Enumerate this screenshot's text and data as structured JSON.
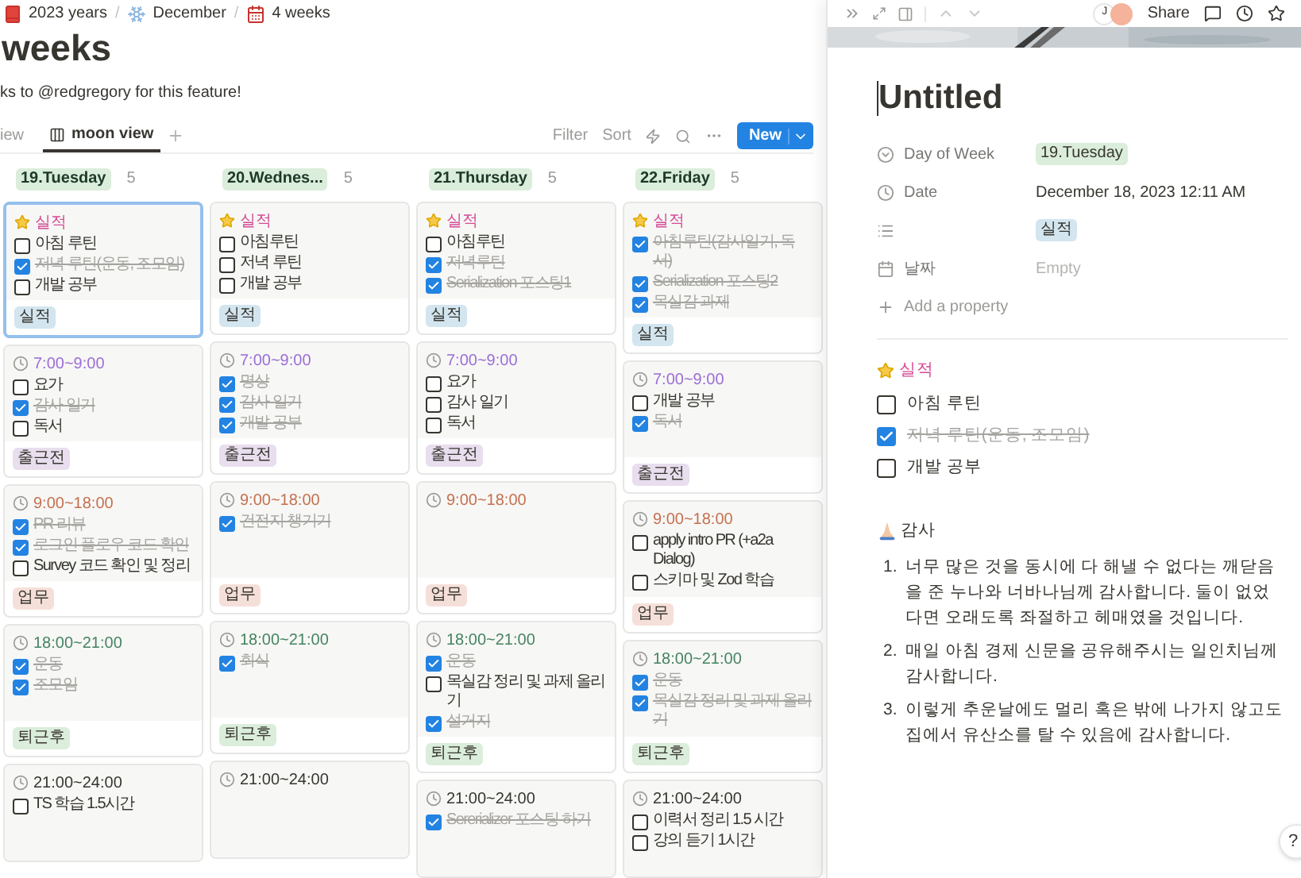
{
  "breadcrumb": [
    {
      "label": "2023 years",
      "kind": "book"
    },
    {
      "separator": "/",
      "label": "December",
      "kind": "snowflake"
    },
    {
      "separator": "/",
      "label": "4 weeks",
      "kind": "calendar"
    }
  ],
  "page": {
    "title": "weeks",
    "description": "ks to @redgregory for this feature!"
  },
  "views": [
    {
      "label": "iew",
      "kind": "plain",
      "selected": false
    },
    {
      "label": "moon view",
      "kind": "board",
      "selected": true
    }
  ],
  "toolbar": {
    "filter": "Filter",
    "sort": "Sort",
    "new_button": "New"
  },
  "columns": [
    {
      "label": "19.Tuesday",
      "count": "5",
      "cards": [
        {
          "kind": "star",
          "title": "실적",
          "color": "#d44c95",
          "selected": true,
          "items": [
            {
              "text": "아침 루틴",
              "checked": false
            },
            {
              "text": "저녁 루틴(운동, 조모임)",
              "checked": true
            },
            {
              "text": "개발 공부",
              "checked": false
            }
          ],
          "tag": {
            "label": "실적",
            "color": "#d3e5ef"
          }
        },
        {
          "kind": "clock",
          "title": "7:00~9:00",
          "color": "#9a6dd7",
          "selected": false,
          "items": [
            {
              "text": "요가",
              "checked": false
            },
            {
              "text": "감사 일기",
              "checked": true
            },
            {
              "text": "독서",
              "checked": false
            }
          ],
          "tag": {
            "label": "출근전",
            "color": "#e8deee"
          }
        },
        {
          "kind": "clock",
          "title": "9:00~18:00",
          "color": "#c4704e",
          "selected": false,
          "items": [
            {
              "text": "PR 리뷰",
              "checked": true
            },
            {
              "text": "로그인 플로우 코드 확인",
              "checked": true
            },
            {
              "text": "Survey 코드 확인 및 정리",
              "checked": false
            }
          ],
          "tag": {
            "label": "업무",
            "color": "#f5e0d9"
          }
        },
        {
          "kind": "clock",
          "title": "18:00~21:00",
          "color": "#448361",
          "selected": false,
          "items": [
            {
              "text": "운동",
              "checked": true
            },
            {
              "text": "조모임",
              "checked": true
            }
          ],
          "tag": {
            "label": "퇴근후",
            "color": "#dbeddb"
          }
        },
        {
          "kind": "clock",
          "title": "21:00~24:00",
          "color": "#37352f",
          "selected": false,
          "items": [
            {
              "text": "TS 학습 1.5시간",
              "checked": false
            }
          ]
        }
      ]
    },
    {
      "label": "20.Wednes...",
      "count": "5",
      "cards": [
        {
          "kind": "star",
          "title": "실적",
          "color": "#d44c95",
          "selected": false,
          "items": [
            {
              "text": "아침루틴",
              "checked": false
            },
            {
              "text": "저녁 루틴",
              "checked": false
            },
            {
              "text": "개발 공부",
              "checked": false
            }
          ],
          "tag": {
            "label": "실적",
            "color": "#d3e5ef"
          }
        },
        {
          "kind": "clock",
          "title": "7:00~9:00",
          "color": "#9a6dd7",
          "selected": false,
          "items": [
            {
              "text": "명상",
              "checked": true
            },
            {
              "text": "감사 일기",
              "checked": true
            },
            {
              "text": "개발 공부",
              "checked": true
            }
          ],
          "tag": {
            "label": "출근전",
            "color": "#e8deee"
          }
        },
        {
          "kind": "clock",
          "title": "9:00~18:00",
          "color": "#c4704e",
          "selected": false,
          "items": [
            {
              "text": "건전지 챙기기",
              "checked": true
            }
          ],
          "tag": {
            "label": "업무",
            "color": "#f5e0d9"
          }
        },
        {
          "kind": "clock",
          "title": "18:00~21:00",
          "color": "#448361",
          "selected": false,
          "items": [
            {
              "text": "회식",
              "checked": true
            }
          ],
          "tag": {
            "label": "퇴근후",
            "color": "#dbeddb"
          }
        },
        {
          "kind": "clock",
          "title": "21:00~24:00",
          "color": "#37352f",
          "selected": false
        }
      ]
    },
    {
      "label": "21.Thursday",
      "count": "5",
      "cards": [
        {
          "kind": "star",
          "title": "실적",
          "color": "#d44c95",
          "selected": false,
          "items": [
            {
              "text": "아침루틴",
              "checked": false
            },
            {
              "text": "저녁루틴",
              "checked": true
            },
            {
              "text": "Serialization 포스팅1",
              "checked": true
            }
          ],
          "tag": {
            "label": "실적",
            "color": "#d3e5ef"
          }
        },
        {
          "kind": "clock",
          "title": "7:00~9:00",
          "color": "#9a6dd7",
          "selected": false,
          "items": [
            {
              "text": "요가",
              "checked": false
            },
            {
              "text": "감사 일기",
              "checked": false
            },
            {
              "text": "독서",
              "checked": false
            }
          ],
          "tag": {
            "label": "출근전",
            "color": "#e8deee"
          }
        },
        {
          "kind": "clock",
          "title": "9:00~18:00",
          "color": "#c4704e",
          "selected": false,
          "tag": {
            "label": "업무",
            "color": "#f5e0d9"
          }
        },
        {
          "kind": "clock",
          "title": "18:00~21:00",
          "color": "#448361",
          "selected": false,
          "items": [
            {
              "text": "운동",
              "checked": true
            },
            {
              "text": "목실감 정리 및 과제 올리기",
              "checked": false
            },
            {
              "text": "설거지",
              "checked": true
            }
          ],
          "tag": {
            "label": "퇴근후",
            "color": "#dbeddb"
          }
        },
        {
          "kind": "clock",
          "title": "21:00~24:00",
          "color": "#37352f",
          "selected": false,
          "items": [
            {
              "text": "Sererializer 포스팅 하기",
              "checked": true
            }
          ]
        }
      ]
    },
    {
      "label": "22.Friday",
      "count": "5",
      "cards": [
        {
          "kind": "star",
          "title": "실적",
          "color": "#d44c95",
          "selected": false,
          "items": [
            {
              "text": "아침루틴(감사일기, 독서)",
              "checked": true
            },
            {
              "text": "Serialization 포스팅2",
              "checked": true
            },
            {
              "text": "목실감 과제",
              "checked": true
            }
          ],
          "tag": {
            "label": "실적",
            "color": "#d3e5ef"
          }
        },
        {
          "kind": "clock",
          "title": "7:00~9:00",
          "color": "#9a6dd7",
          "selected": false,
          "items": [
            {
              "text": "개발 공부",
              "checked": false
            },
            {
              "text": "독서",
              "checked": true
            }
          ],
          "tag": {
            "label": "출근전",
            "color": "#e8deee"
          }
        },
        {
          "kind": "clock",
          "title": "9:00~18:00",
          "color": "#c4704e",
          "selected": false,
          "items": [
            {
              "text": "apply intro PR (+a2a Dialog)",
              "checked": false
            },
            {
              "text": "스키마 및 Zod 학습",
              "checked": false
            }
          ],
          "tag": {
            "label": "업무",
            "color": "#f5e0d9"
          }
        },
        {
          "kind": "clock",
          "title": "18:00~21:00",
          "color": "#448361",
          "selected": false,
          "items": [
            {
              "text": "운동",
              "checked": true
            },
            {
              "text": "목실감 정리 및 과제 올리기",
              "checked": true
            }
          ],
          "tag": {
            "label": "퇴근후",
            "color": "#dbeddb"
          }
        },
        {
          "kind": "clock",
          "title": "21:00~24:00",
          "color": "#37352f",
          "selected": false,
          "items": [
            {
              "text": "이력서 정리 1.5 시간",
              "checked": false
            },
            {
              "text": "강의 듣기 1시간",
              "checked": false
            }
          ]
        }
      ]
    }
  ],
  "detail": {
    "avatar": "J",
    "share": "Share",
    "title": "Untitled",
    "properties": [
      {
        "kind": "select",
        "name": "Day of Week",
        "value": "19.Tuesday",
        "color": "#dbeddb"
      },
      {
        "kind": "created",
        "name": "Date",
        "value": "December 18, 2023 12:11 AM"
      },
      {
        "kind": "multi_select",
        "value": "실적",
        "color": "#d3e5ef"
      },
      {
        "kind": "date",
        "name": "날짜",
        "value": "Empty"
      }
    ],
    "add_property": "Add a property",
    "achievement": {
      "title": "실적",
      "items": [
        {
          "text": "아침 루틴",
          "checked": false
        },
        {
          "text": "저녁 루틴(운동, 조모임)",
          "checked": true
        },
        {
          "text": "개발 공부",
          "checked": false
        }
      ]
    },
    "gratitude": {
      "title": "감사",
      "items": [
        {
          "number": "1.",
          "text": "너무 많은 것을 동시에 다 해낼 수 없다는 깨닫음을 준 누나와 너바나님께 감사합니다. 둘이 없었다면 오래도록 좌절하고 헤매였을 것입니다."
        },
        {
          "number": "2.",
          "text": "매일 아침 경제 신문을 공유해주시는 일인치님께 감사합니다."
        },
        {
          "number": "3.",
          "text": "이렇게 추운날에도 멀리 혹은 밖에 나가지 않고도 집에서 유산소를 탈 수 있음에 감사합니다."
        }
      ]
    },
    "help": "?"
  }
}
